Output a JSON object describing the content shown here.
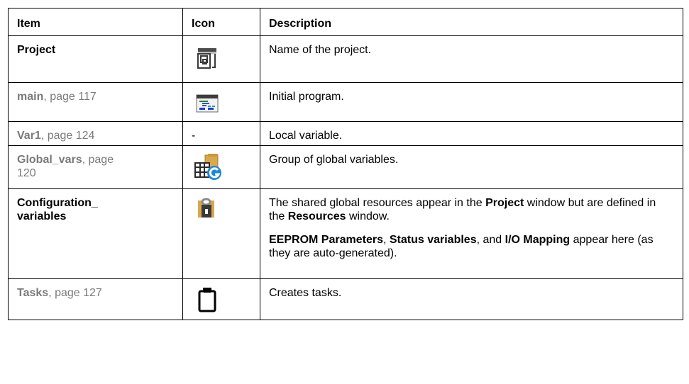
{
  "headers": {
    "item": "Item",
    "icon": "Icon",
    "description": "Description"
  },
  "rows": [
    {
      "item": "Project",
      "item_is_link": false,
      "icon": "project-icon",
      "description": "Name of the project."
    },
    {
      "item_name": "main",
      "item_page": ", page 117",
      "item_is_link": true,
      "icon": "program-icon",
      "description": "Initial program."
    },
    {
      "item_name": "Var1",
      "item_page": ", page 124",
      "item_is_link": true,
      "icon_text": "-",
      "description": "Local variable."
    },
    {
      "item_name": "Global_vars",
      "item_page": ", page",
      "item_page_line2": "120",
      "item_is_link": true,
      "icon": "global-variables-icon",
      "description": "Group of global variables."
    },
    {
      "item_line1": "Configuration_",
      "item_line2": "variables",
      "item_is_link": false,
      "icon": "locked-folder-icon",
      "description_p1": {
        "t1": "The shared global resources appear in the ",
        "b1": "Project",
        "t2": " window but are defined in the ",
        "b2": "Resources",
        "t3": " window."
      },
      "description_p2": {
        "b1": "EEPROM Parameters",
        "t1": ", ",
        "b2": "Status variables",
        "t2": ", and ",
        "b3": "I/O Mapping",
        "t3": " appear here (as they are auto-generated)."
      }
    },
    {
      "item_name": "Tasks",
      "item_page": ", page 127",
      "item_is_link": true,
      "icon": "task-icon",
      "description": "Creates tasks."
    }
  ],
  "colors": {
    "link": "#7a7a7a",
    "border": "#000000",
    "text": "#000000"
  }
}
